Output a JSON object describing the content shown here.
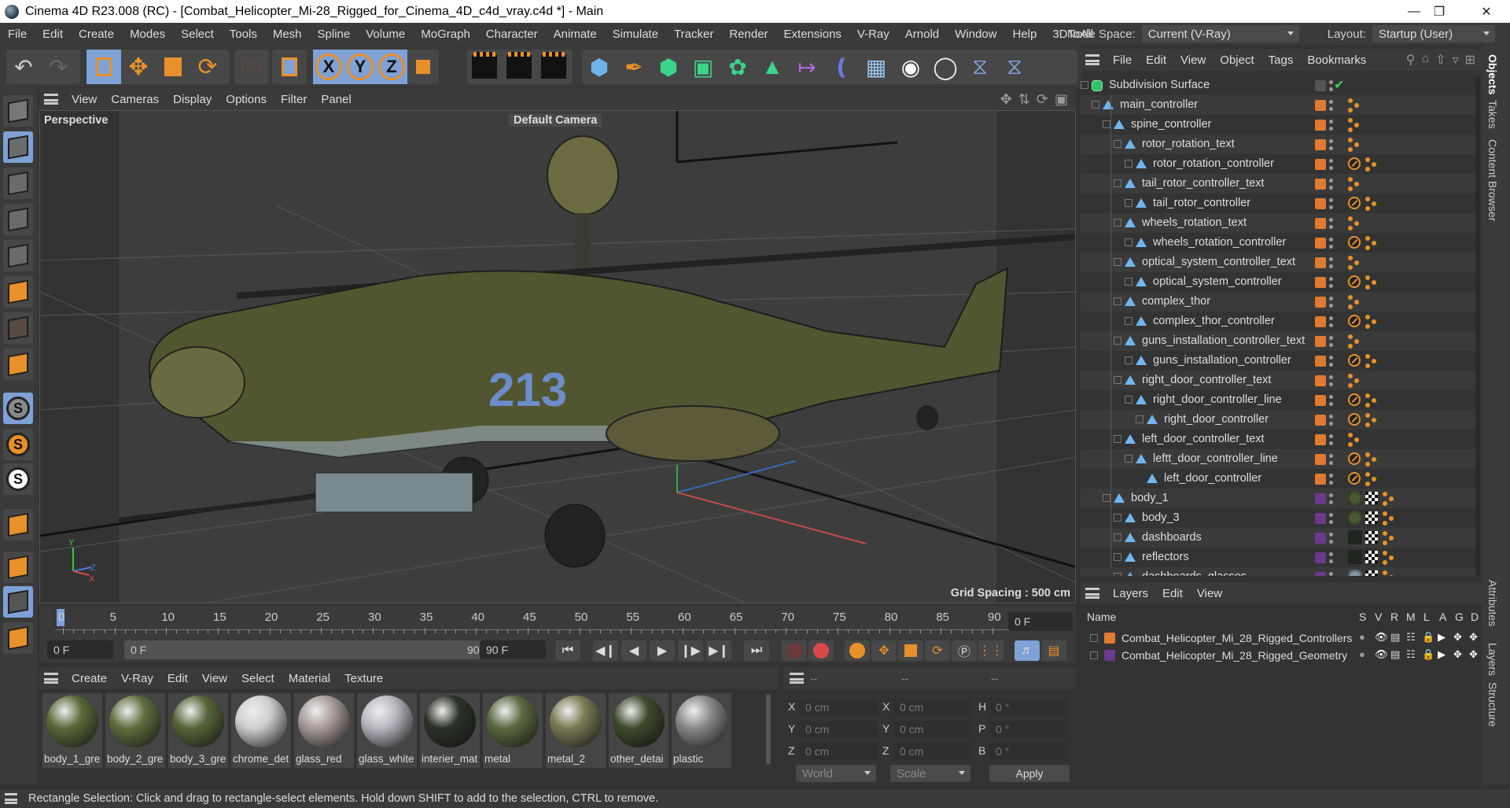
{
  "window": {
    "title": "Cinema 4D R23.008 (RC) - [Combat_Helicopter_Mi-28_Rigged_for_Cinema_4D_c4d_vray.c4d *] - Main",
    "controls": [
      "minimize",
      "restore",
      "close"
    ]
  },
  "menubar": {
    "items": [
      "File",
      "Edit",
      "Create",
      "Modes",
      "Select",
      "Tools",
      "Mesh",
      "Spline",
      "Volume",
      "MoGraph",
      "Character",
      "Animate",
      "Simulate",
      "Tracker",
      "Render",
      "Extensions",
      "V-Ray",
      "Arnold",
      "Window",
      "Help",
      "3DToAll"
    ],
    "node_space_label": "Node Space:",
    "node_space_value": "Current (V-Ray)",
    "layout_label": "Layout:",
    "layout_value": "Startup (User)"
  },
  "toolbar": {
    "buttons": [
      "undo",
      "redo",
      "live-selection",
      "move",
      "scale",
      "rotate",
      "recent-tools",
      "rectangle-selection",
      "x-axis",
      "y-axis",
      "z-axis",
      "coordinate-system",
      "render-view",
      "render-to-picture-viewer",
      "render-settings",
      "cube",
      "pen",
      "subdivision-surface",
      "extrude",
      "cloner",
      "array",
      "bend",
      "deformer",
      "floor",
      "camera",
      "light",
      "python",
      "python-2"
    ],
    "axis_labels": [
      "X",
      "Y",
      "Z"
    ]
  },
  "left_tools": [
    "make-editable",
    "model-mode",
    "texture-mode",
    "points-mode",
    "edges-mode",
    "polygons-mode",
    "uv-mode",
    "axis-mode",
    "snap",
    "snap-settings",
    "workplane-snap",
    "magnet",
    "workplane",
    "locked-workplane",
    "lasso"
  ],
  "viewport": {
    "menu": [
      "View",
      "Cameras",
      "Display",
      "Options",
      "Filter",
      "Panel"
    ],
    "name": "Perspective",
    "camera": "Default Camera",
    "grid_spacing": "Grid Spacing : 500 cm",
    "nav_icons": [
      "move-view",
      "dolly",
      "rotate-view",
      "maximize-view"
    ]
  },
  "timeline": {
    "ticks": [
      "0",
      "5",
      "10",
      "15",
      "20",
      "25",
      "30",
      "35",
      "40",
      "45",
      "50",
      "55",
      "60",
      "65",
      "70",
      "75",
      "80",
      "85",
      "90"
    ],
    "current_frame_display": "0 F",
    "start_field": "0 F",
    "range_start": "0 F",
    "range_end": "90 F",
    "end_field": "90 F"
  },
  "material_manager": {
    "menu": [
      "Create",
      "V-Ray",
      "Edit",
      "View",
      "Select",
      "Material",
      "Texture"
    ],
    "materials": [
      {
        "name": "body_1_gre",
        "color": "#5a6a3a"
      },
      {
        "name": "body_2_gre",
        "color": "#5f6f40"
      },
      {
        "name": "body_3_gre",
        "color": "#56663a"
      },
      {
        "name": "chrome_det",
        "color": "#cfcfcf"
      },
      {
        "name": "glass_red",
        "color": "#a89a9a"
      },
      {
        "name": "glass_white",
        "color": "#b8b8c0"
      },
      {
        "name": "interier_mat",
        "color": "#2c3228"
      },
      {
        "name": "metal",
        "color": "#5c6a40"
      },
      {
        "name": "metal_2",
        "color": "#7a7a55"
      },
      {
        "name": "other_detai",
        "color": "#3e4a2c"
      },
      {
        "name": "plastic",
        "color": "#8a8a8a"
      }
    ]
  },
  "coordinates": {
    "headers": [
      "--",
      "--",
      "--"
    ],
    "rows": [
      {
        "l1": "X",
        "v1": "0 cm",
        "l2": "X",
        "v2": "0 cm",
        "l3": "H",
        "v3": "0 °"
      },
      {
        "l1": "Y",
        "v1": "0 cm",
        "l2": "Y",
        "v2": "0 cm",
        "l3": "P",
        "v3": "0 °"
      },
      {
        "l1": "Z",
        "v1": "0 cm",
        "l2": "Z",
        "v2": "0 cm",
        "l3": "B",
        "v3": "0 °"
      }
    ],
    "mode_select": "World",
    "scale_select": "Scale",
    "apply_label": "Apply"
  },
  "object_manager": {
    "menu": [
      "File",
      "Edit",
      "View",
      "Object",
      "Tags",
      "Bookmarks"
    ],
    "objects": [
      {
        "name": "Subdivision Surface",
        "depth": 0,
        "type": "subdiv",
        "layer": "none",
        "tags": "check"
      },
      {
        "name": "main_controller",
        "depth": 1,
        "type": "null",
        "layer": "orange",
        "tags": "joint"
      },
      {
        "name": "spine_controller",
        "depth": 2,
        "type": "null",
        "layer": "orange",
        "tags": "joint"
      },
      {
        "name": "rotor_rotation_text",
        "depth": 3,
        "type": "null",
        "layer": "orange",
        "tags": "joint"
      },
      {
        "name": "rotor_rotation_controller",
        "depth": 4,
        "type": "null",
        "layer": "orange",
        "tags": "protect-joint"
      },
      {
        "name": "tail_rotor_controller_text",
        "depth": 3,
        "type": "null",
        "layer": "orange",
        "tags": "joint"
      },
      {
        "name": "tail_rotor_controller",
        "depth": 4,
        "type": "null",
        "layer": "orange",
        "tags": "protect-joint"
      },
      {
        "name": "wheels_rotation_text",
        "depth": 3,
        "type": "null",
        "layer": "orange",
        "tags": "joint"
      },
      {
        "name": "wheels_rotation_controller",
        "depth": 4,
        "type": "null",
        "layer": "orange",
        "tags": "protect-joint"
      },
      {
        "name": "optical_system_controller_text",
        "depth": 3,
        "type": "null",
        "layer": "orange",
        "tags": "joint"
      },
      {
        "name": "optical_system_controller",
        "depth": 4,
        "type": "null",
        "layer": "orange",
        "tags": "protect-joint"
      },
      {
        "name": "complex_thor",
        "depth": 3,
        "type": "null",
        "layer": "orange",
        "tags": "joint"
      },
      {
        "name": "complex_thor_controller",
        "depth": 4,
        "type": "null",
        "layer": "orange",
        "tags": "protect-joint"
      },
      {
        "name": "guns_installation_controller_text",
        "depth": 3,
        "type": "null",
        "layer": "orange",
        "tags": "joint"
      },
      {
        "name": "guns_installation_controller",
        "depth": 4,
        "type": "null",
        "layer": "orange",
        "tags": "protect-joint"
      },
      {
        "name": "right_door_controller_text",
        "depth": 3,
        "type": "null",
        "layer": "orange",
        "tags": "joint"
      },
      {
        "name": "right_door_controller_line",
        "depth": 4,
        "type": "null",
        "layer": "orange",
        "tags": "protect-joint"
      },
      {
        "name": "right_door_controller",
        "depth": 5,
        "type": "null",
        "layer": "orange",
        "tags": "protect-joint"
      },
      {
        "name": "left_door_controller_text",
        "depth": 3,
        "type": "null",
        "layer": "orange",
        "tags": "joint"
      },
      {
        "name": "leftt_door_controller_line",
        "depth": 4,
        "type": "null",
        "layer": "orange",
        "tags": "protect-joint"
      },
      {
        "name": "left_door_controller",
        "depth": 5,
        "type": "null",
        "layer": "orange",
        "tags": "protect-joint"
      },
      {
        "name": "body_1",
        "depth": 2,
        "type": "null",
        "layer": "purple",
        "tags": "material"
      },
      {
        "name": "body_3",
        "depth": 3,
        "type": "null",
        "layer": "purple",
        "tags": "material"
      },
      {
        "name": "dashboards",
        "depth": 3,
        "type": "null",
        "layer": "purple",
        "tags": "material-dark"
      },
      {
        "name": "reflectors",
        "depth": 3,
        "type": "null",
        "layer": "purple",
        "tags": "material-dark"
      },
      {
        "name": "dashboards_glasses",
        "depth": 3,
        "type": "null",
        "layer": "purple",
        "tags": "material-glass"
      }
    ]
  },
  "layers_manager": {
    "menu": [
      "Layers",
      "Edit",
      "View"
    ],
    "columns": [
      "Name",
      "S",
      "V",
      "R",
      "M",
      "L",
      "A",
      "G",
      "D"
    ],
    "layers": [
      {
        "name": "Combat_Helicopter_Mi_28_Rigged_Controllers",
        "color": "#e07a30"
      },
      {
        "name": "Combat_Helicopter_Mi_28_Rigged_Geometry",
        "color": "#6a3a8c"
      }
    ]
  },
  "right_tabs": [
    "Objects",
    "Takes",
    "Content Browser",
    "Attributes",
    "Layers",
    "Structure"
  ],
  "status_bar": {
    "text": "Rectangle Selection: Click and drag to rectangle-select elements. Hold down SHIFT to add to the selection, CTRL to remove."
  },
  "colors": {
    "accent_blue": "#7ea1d6",
    "accent_orange": "#e8912a",
    "layer_orange": "#e07a30",
    "layer_purple": "#6a3a8c",
    "null_blue": "#72b6ef"
  }
}
